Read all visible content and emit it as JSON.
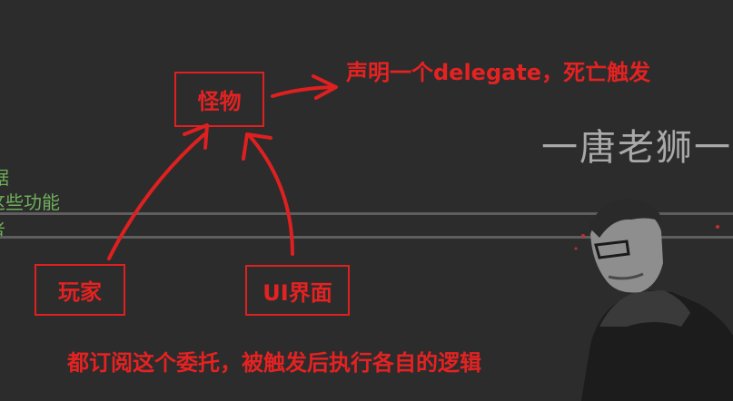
{
  "diagram": {
    "nodes": {
      "monster": "怪物",
      "player": "玩家",
      "ui": "UI界面"
    },
    "notes": {
      "declare": "声明一个delegate，死亡触发",
      "subscribe": "都订阅这个委托，被触发后执行各自的逻辑"
    },
    "edges": [
      {
        "from": "player",
        "to": "monster"
      },
      {
        "from": "ui",
        "to": "monster"
      },
      {
        "from": "monster",
        "to": "declare"
      }
    ]
  },
  "watermark": "一唐老狮一",
  "background_code": {
    "line1": "据",
    "line2": "这些功能",
    "line3": "者"
  },
  "colors": {
    "accent": "#e02020",
    "background": "#2c2c2c",
    "code_green": "#6fae5a",
    "watermark": "#a9a9a9"
  }
}
